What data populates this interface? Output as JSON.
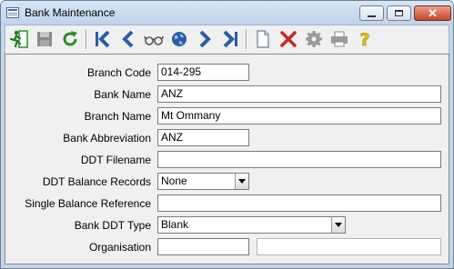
{
  "window": {
    "title": "Bank Maintenance"
  },
  "toolbar": {
    "buttons": [
      {
        "name": "exit",
        "icon": "exit-door-icon"
      },
      {
        "name": "save",
        "icon": "save-disk-icon"
      },
      {
        "name": "refresh",
        "icon": "refresh-icon"
      },
      {
        "name": "first",
        "icon": "first-record-icon"
      },
      {
        "name": "previous",
        "icon": "previous-record-icon"
      },
      {
        "name": "view",
        "icon": "glasses-icon"
      },
      {
        "name": "web",
        "icon": "globe-icon"
      },
      {
        "name": "next",
        "icon": "next-record-icon"
      },
      {
        "name": "last",
        "icon": "last-record-icon"
      },
      {
        "name": "new",
        "icon": "new-document-icon"
      },
      {
        "name": "delete",
        "icon": "delete-x-icon"
      },
      {
        "name": "settings",
        "icon": "gear-icon"
      },
      {
        "name": "print",
        "icon": "printer-icon"
      },
      {
        "name": "help",
        "icon": "help-question-icon"
      }
    ]
  },
  "form": {
    "branch_code": {
      "label": "Branch Code",
      "value": "014-295"
    },
    "bank_name": {
      "label": "Bank Name",
      "value": "ANZ"
    },
    "branch_name": {
      "label": "Branch Name",
      "value": "Mt Ommany"
    },
    "bank_abbreviation": {
      "label": "Bank Abbreviation",
      "value": "ANZ"
    },
    "ddt_filename": {
      "label": "DDT Filename",
      "value": ""
    },
    "ddt_balance_records": {
      "label": "DDT Balance Records",
      "value": "None"
    },
    "single_balance_reference": {
      "label": "Single Balance Reference",
      "value": ""
    },
    "bank_ddt_type": {
      "label": "Bank DDT Type",
      "value": "Blank"
    },
    "organisation": {
      "label": "Organisation",
      "value": "",
      "description": ""
    }
  },
  "colors": {
    "accent": "#2b5ca8",
    "refresh_green": "#2e8b2e",
    "delete_red": "#c62828",
    "help_yellow": "#e7c300"
  }
}
